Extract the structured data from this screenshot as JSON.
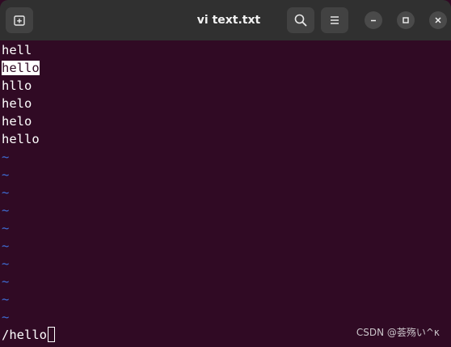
{
  "window": {
    "title": "vi text.txt",
    "icons": {
      "new_tab": "new-tab-icon",
      "search": "search-icon",
      "menu": "hamburger-menu-icon",
      "minimize": "minimize-icon",
      "maximize": "maximize-icon",
      "close": "close-icon"
    }
  },
  "buffer": {
    "lines": [
      {
        "text": "hell",
        "highlighted": false
      },
      {
        "text": "hello",
        "highlighted": true
      },
      {
        "text": "hllo",
        "highlighted": false
      },
      {
        "text": "helo",
        "highlighted": false
      },
      {
        "text": "helo",
        "highlighted": false
      },
      {
        "text": "hello",
        "highlighted": false
      }
    ],
    "empty_line_marker": "~",
    "empty_line_count": 10
  },
  "command_line": {
    "text": "/hello"
  },
  "watermark": "CSDN @荟殇い^κ",
  "colors": {
    "background": "#300a24",
    "titlebar": "#303030",
    "text": "#ffffff",
    "tilde": "#3f6fd8",
    "search_highlight": "#ffffff"
  }
}
